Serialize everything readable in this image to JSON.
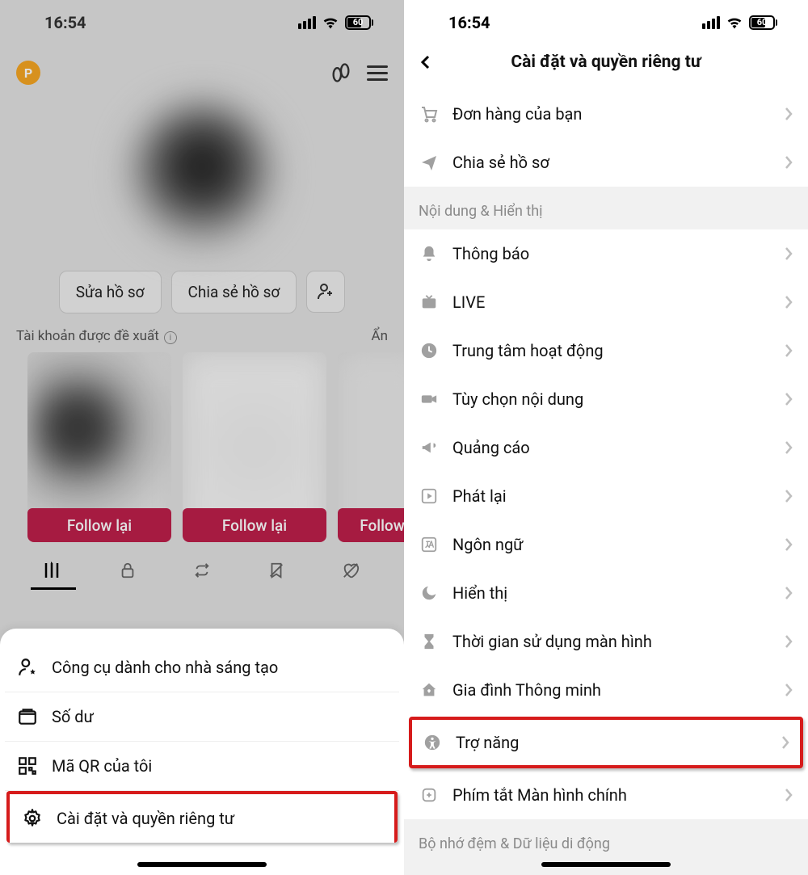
{
  "status": {
    "time": "16:54",
    "battery": "60"
  },
  "left": {
    "p_badge": "P",
    "buttons": {
      "edit_profile": "Sửa hồ sơ",
      "share_profile": "Chia sẻ hồ sơ"
    },
    "suggested_label": "Tài khoản được đề xuất",
    "hide_label": "Ẩn",
    "follow_btn": "Follow lại",
    "follow_btn_partial": "Follow",
    "sheet": {
      "creator_tools": "Công cụ dành cho nhà sáng tạo",
      "balance": "Số dư",
      "my_qr": "Mã QR của tôi",
      "settings_privacy": "Cài đặt và quyền riêng tư"
    }
  },
  "right": {
    "title": "Cài đặt và quyền riêng tư",
    "top": {
      "orders": "Đơn hàng của bạn",
      "share_profile": "Chia sẻ hồ sơ"
    },
    "section_content": "Nội dung & Hiển thị",
    "items": {
      "notifications": "Thông báo",
      "live": "LIVE",
      "activity_center": "Trung tâm hoạt động",
      "content_pref": "Tùy chọn nội dung",
      "ads": "Quảng cáo",
      "playback": "Phát lại",
      "language": "Ngôn ngữ",
      "display": "Hiển thị",
      "screen_time": "Thời gian sử dụng màn hình",
      "family_pairing": "Gia đình Thông minh",
      "accessibility": "Trợ năng",
      "home_shortcut": "Phím tắt Màn hình chính"
    },
    "section_cache": "Bộ nhớ đệm & Dữ liệu di động"
  }
}
